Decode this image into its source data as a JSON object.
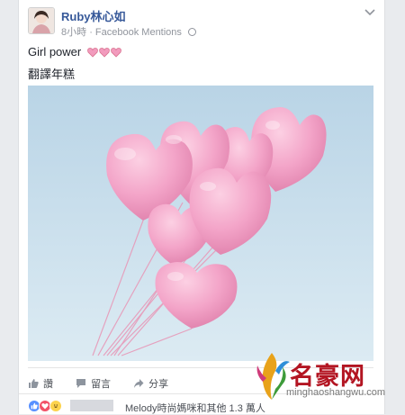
{
  "post": {
    "author": "Ruby林心如",
    "time": "8小時",
    "separator": "·",
    "source": "Facebook Mentions",
    "text_line1": "Girl power",
    "text_line2": "翻譯年糕"
  },
  "actions": {
    "like": "讚",
    "comment": "留言",
    "share": "分享"
  },
  "reactions": {
    "summary": "Melody時尚媽咪和其他 1.3 萬人",
    "types": [
      "like-icon",
      "love-icon",
      "haha-icon"
    ]
  },
  "watermark": {
    "title": "名豪网",
    "url": "minghaoshangwu.com"
  },
  "colors": {
    "link": "#365899",
    "sky": "#c5dceb",
    "balloon": "#f5a6cb",
    "watermark_red": "#b31522"
  }
}
